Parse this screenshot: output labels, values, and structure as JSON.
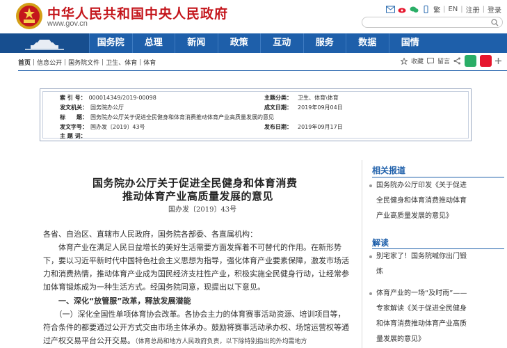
{
  "header": {
    "title": "中华人民共和国中央人民政府",
    "url": "www.gov.cn",
    "links": {
      "trad": "繁",
      "en": "EN",
      "register": "注册",
      "login": "登录"
    }
  },
  "nav": {
    "items": [
      "国务院",
      "总理",
      "新闻",
      "政策",
      "互动",
      "服务",
      "数据",
      "国情"
    ]
  },
  "breadcrumb": [
    "首页",
    "信息公开",
    "国务院文件",
    "卫生、体育",
    "体育"
  ],
  "tools": {
    "favorite": "收藏",
    "comment": "留言"
  },
  "info": {
    "index_label": "索 引 号：",
    "index_value": "000014349/2019-00098",
    "topic_label": "主题分类：",
    "topic_value": "卫生、体育\\体育",
    "issuer_label": "发文机关：",
    "issuer_value": "国务院办公厅",
    "date_label": "成文日期：",
    "date_value": "2019年09月04日",
    "title_label": "标　　题：",
    "title_value": "国务院办公厅关于促进全民健身和体育消费推动体育产业高质量发展的意见",
    "docno_label": "发文字号：",
    "docno_value": "国办发〔2019〕43号",
    "pubdate_label": "发布日期：",
    "pubdate_value": "2019年09月17日",
    "subject_label": "主 题 词：",
    "subject_value": ""
  },
  "article": {
    "title_line1": "国务院办公厅关于促进全民健身和体育消费",
    "title_line2": "推动体育产业高质量发展的意见",
    "doc_number": "国办发〔2019〕43号",
    "greeting": "各省、自治区、直辖市人民政府，国务院各部委、各直属机构：",
    "para1_l1": "　　体育产业在满足人民日益增长的美好生活需要方面发挥着不可替代的作用。在新形势",
    "para1_l2": "下，要以习近平新时代中国特色社会主义思想为指导，强化体育产业要素保障，激发市场活",
    "para1_l3": "力和消费热情，推动体育产业成为国民经济支柱性产业，积极实施全民健身行动，让经常参",
    "para1_l4": "加体育锻炼成为一种生活方式。经国务院同意，现提出以下意见。",
    "heading1": "　　一、深化“放管服”改革，释放发展潜能",
    "para2_l1": "　　（一）深化全国性单项体育协会改革。各协会主力的体育赛事活动资源、培训项目等，",
    "para2_l2": "符合条件的都要通过公开方式交由市场主体承办。鼓励将赛事活动承办权、场馆运营权等通",
    "para2_l3a": "过产权交易平台公开交易。",
    "para2_l3b": "（体育总局和地方人民政府负责，以下除特别指出的外均需地方"
  },
  "sidebar": {
    "related_heading": "相关报道",
    "related": [
      "国务院办公厅印发《关于促进",
      "全民健身和体育消费推动体育",
      "产业高质量发展的意见》"
    ],
    "reading_heading": "解读",
    "reading1": [
      "别宅家了！国务院喊你出门锻",
      "炼"
    ],
    "reading2": [
      "体育产业的一场“及时雨”——",
      "专家解读《关于促进全民健身",
      "和体育消费推动体育产业高质",
      "量发展的意见》"
    ]
  },
  "colors": {
    "brand_red": "#c4161c",
    "nav_blue": "#1e5faa"
  }
}
